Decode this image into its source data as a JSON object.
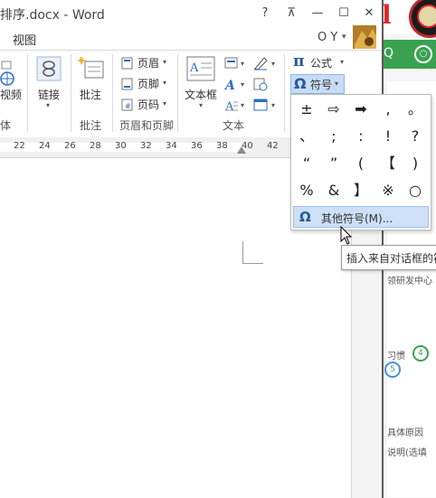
{
  "window": {
    "title": "排序.docx - Word",
    "help": "?",
    "restore_ribbon": "⊼",
    "minimize": "—",
    "maximize": "☐",
    "close": "✕",
    "user": "O Y",
    "user_caret": "▾"
  },
  "tabs": {
    "view": "视图"
  },
  "ribbon": {
    "media": {
      "label": "视频",
      "group": "体"
    },
    "links": {
      "label": "链接"
    },
    "comments": {
      "label": "批注",
      "group": "批注"
    },
    "header_footer": {
      "header": "页眉",
      "footer": "页脚",
      "page_number": "页码",
      "group": "页眉和页脚"
    },
    "text": {
      "textbox": "文本框",
      "group": "文本"
    },
    "symbols": {
      "equation": "公式",
      "symbol": "符号",
      "pi": "π",
      "omega": "Ω"
    }
  },
  "ruler": {
    "ticks": [
      "22",
      "24",
      "26",
      "28",
      "30",
      "32",
      "34",
      "36",
      "38",
      "40",
      "42"
    ]
  },
  "symbol_menu": {
    "symbols": [
      "±",
      "⇨",
      "➡",
      ",",
      "。",
      "、",
      ";",
      ":",
      "!",
      "?",
      "“",
      "”",
      "(",
      "【",
      ")",
      "%",
      "&",
      "】",
      "※",
      "○"
    ],
    "more_icon": "Ω",
    "more_label": "其他符号(M)..."
  },
  "tooltip": {
    "text": "插入来自对话框的符号"
  },
  "background_page": {
    "logo_text": "l",
    "bar_text": "Q",
    "user_icon": "○",
    "lines": [
      "领研发中心",
      "习惯",
      "具体原因",
      "说明(选填"
    ],
    "pill_green": "4",
    "pill_blue": "5"
  }
}
